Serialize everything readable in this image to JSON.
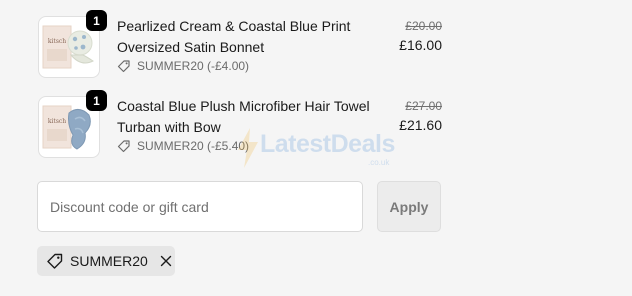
{
  "cart": {
    "items": [
      {
        "quantity": "1",
        "name": "Pearlized Cream & Coastal Blue Print Oversized Satin Bonnet",
        "discount": "SUMMER20 (-£4.00)",
        "original_price": "£20.00",
        "price": "£16.00",
        "thumb_brand": "kitsch"
      },
      {
        "quantity": "1",
        "name": "Coastal Blue Plush Microfiber Hair Towel Turban with Bow",
        "discount": "SUMMER20 (-£5.40)",
        "original_price": "£27.00",
        "price": "£21.60",
        "thumb_brand": "kitsch"
      }
    ]
  },
  "discount_form": {
    "placeholder": "Discount code or gift card",
    "apply_label": "Apply",
    "applied_code": "SUMMER20"
  },
  "watermark": {
    "text": "LatestDeals",
    "sub": ".co.uk"
  },
  "colors": {
    "background": "#f5f5f5",
    "badge": "#000000",
    "chip": "#e6e6e6",
    "watermark": "#4a8ad4"
  },
  "icons": [
    "tag-icon",
    "close-icon",
    "lightning-icon"
  ]
}
